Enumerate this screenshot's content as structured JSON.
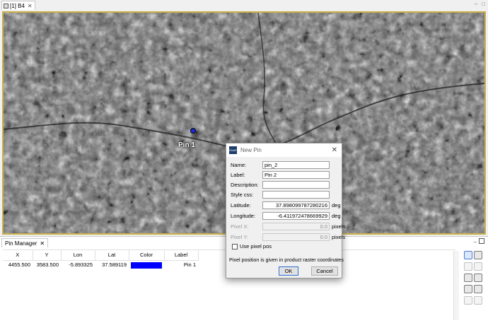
{
  "editor": {
    "tab_title": "[1] B4"
  },
  "view": {
    "pin_label": "Pin 1",
    "border_color": "#c9b14a"
  },
  "pin_manager": {
    "title": "Pin Manager",
    "columns": [
      "X",
      "Y",
      "Lon",
      "Lat",
      "Color",
      "Label"
    ],
    "rows": [
      {
        "x": "4455.500",
        "y": "3583.500",
        "lon": "-5.893325",
        "lat": "37.589119",
        "color": "#0000ff",
        "label": "Pin 1"
      }
    ],
    "tools": [
      "new-pin",
      "copy-pin",
      "edit-pin",
      "remove-pin",
      "import-pins",
      "export-pins",
      "filter-pins",
      "export-table",
      "zoom-to-pin",
      "transfer-pins"
    ]
  },
  "dialog": {
    "title": "New Pin",
    "name_label": "Name:",
    "name_value": "pin_2",
    "label_label": "Label:",
    "label_value": "Pin 2",
    "description_label": "Description:",
    "description_value": "",
    "style_label": "Style css:",
    "style_value": "",
    "latitude_label": "Latitude:",
    "latitude_value": "37.898099787280216",
    "latitude_unit": "deg",
    "longitude_label": "Longitude:",
    "longitude_value": "-6.411972478669929",
    "longitude_unit": "deg",
    "pixel_x_label": "Pixel X:",
    "pixel_x_value": "0.0",
    "pixel_x_unit": "pixels",
    "pixel_y_label": "Pixel Y:",
    "pixel_y_value": "0.0",
    "pixel_y_unit": "pixels",
    "use_pixel_pos_label": "Use pixel pos",
    "note": "Pixel position is given in product raster coordinates",
    "ok_label": "OK",
    "cancel_label": "Cancel"
  }
}
